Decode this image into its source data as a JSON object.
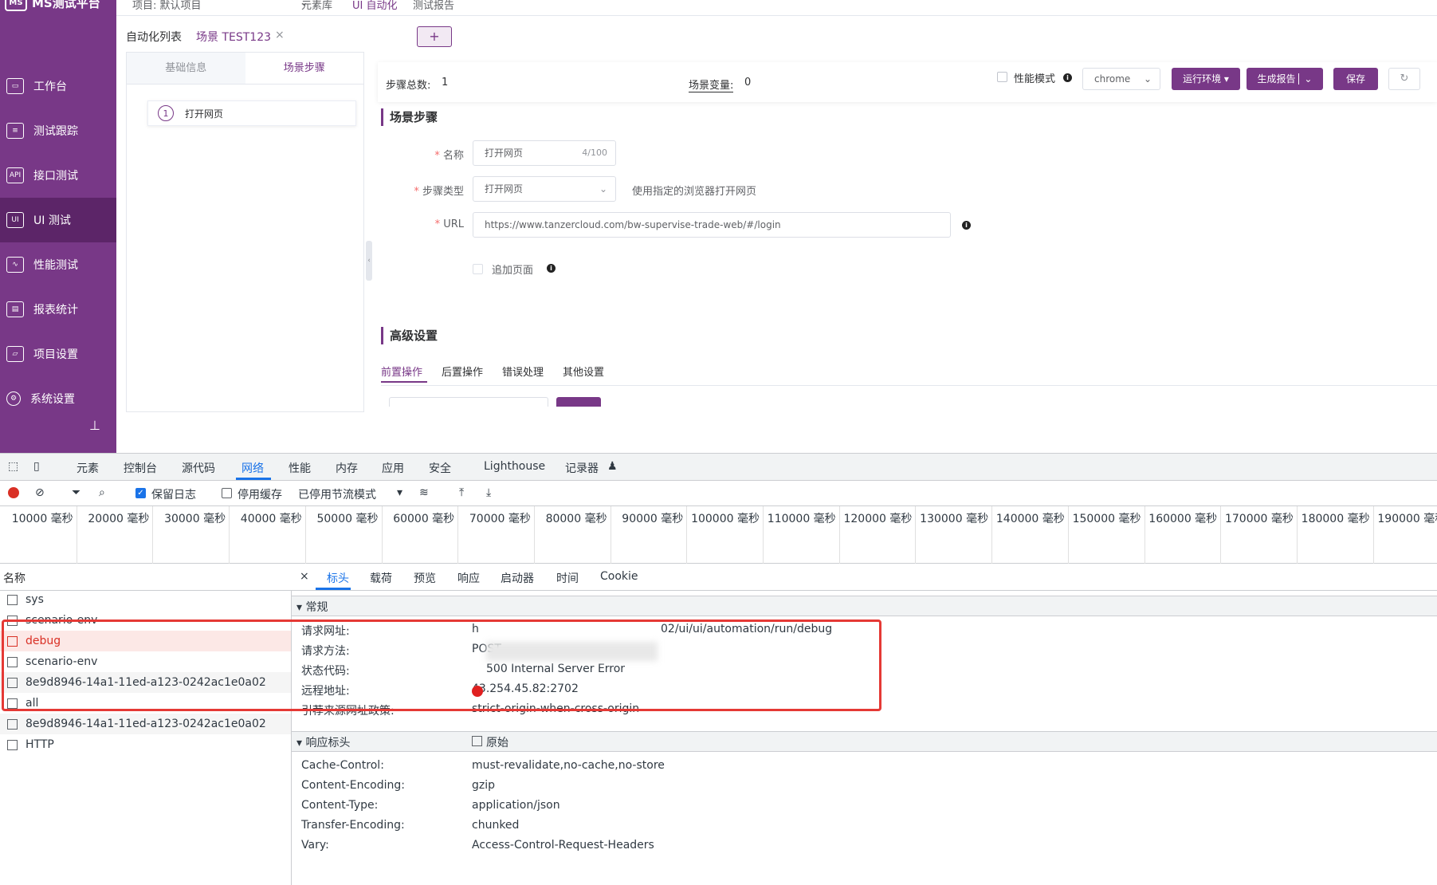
{
  "app": {
    "logo_text": "MS测试平台",
    "logo_mark": "MS"
  },
  "topbar": {
    "project": "项目: 默认项目",
    "tabs": [
      "元素库",
      "UI 自动化",
      "测试报告"
    ]
  },
  "sidebar": {
    "items": [
      {
        "label": "工作台",
        "icon": "monitor-icon"
      },
      {
        "label": "测试跟踪",
        "icon": "clipboard-icon"
      },
      {
        "label": "接口测试",
        "icon": "api-icon"
      },
      {
        "label": "UI 测试",
        "icon": "ui-icon",
        "active": true
      },
      {
        "label": "性能测试",
        "icon": "chart-icon"
      },
      {
        "label": "报表统计",
        "icon": "report-icon"
      },
      {
        "label": "项目设置",
        "icon": "folder-icon"
      },
      {
        "label": "系统设置",
        "icon": "gear-icon"
      }
    ]
  },
  "page_tabs": {
    "list": "自动化列表",
    "scene": "场景 TEST123",
    "close": "×",
    "add": "+"
  },
  "left_panel": {
    "tab_basic": "基础信息",
    "tab_steps": "场景步骤",
    "step_num": "1",
    "step_label": "打开网页"
  },
  "toolbar": {
    "steps_total_label": "步骤总数:",
    "steps_total": "1",
    "scene_var_label": "场景变量:",
    "scene_var": "0",
    "perf_mode": "性能模式",
    "browser": "chrome",
    "run_env": "运行环境",
    "gen_report": "生成报告",
    "save": "保存",
    "accent": "#783887"
  },
  "scene_steps": {
    "title": "场景步骤",
    "name_label": "名称",
    "name_value": "打开网页",
    "name_count": "4/100",
    "type_label": "步骤类型",
    "type_value": "打开网页",
    "type_hint": "使用指定的浏览器打开网页",
    "url_label": "URL",
    "url_value": "https://www.tanzercloud.com/bw-supervise-trade-web/#/login",
    "append_page": "追加页面"
  },
  "advanced": {
    "title": "高级设置",
    "tabs": [
      "前置操作",
      "后置操作",
      "错误处理",
      "其他设置"
    ]
  },
  "devtools": {
    "tabs": [
      "元素",
      "控制台",
      "源代码",
      "网络",
      "性能",
      "内存",
      "应用",
      "安全",
      "Lighthouse",
      "记录器"
    ],
    "preserve_log": "保留日志",
    "disable_cache": "停用缓存",
    "throttle": "已停用节流模式",
    "ticks": [
      "10000 毫秒",
      "20000 毫秒",
      "30000 毫秒",
      "40000 毫秒",
      "50000 毫秒",
      "60000 毫秒",
      "70000 毫秒",
      "80000 毫秒",
      "90000 毫秒",
      "100000 毫秒",
      "110000 毫秒",
      "120000 毫秒",
      "130000 毫秒",
      "140000 毫秒",
      "150000 毫秒",
      "160000 毫秒",
      "170000 毫秒",
      "180000 毫秒",
      "190000 毫秒"
    ],
    "name_header": "名称",
    "requests": [
      "sys",
      "scenario-env",
      "debug",
      "scenario-env",
      "8e9d8946-14a1-11ed-a123-0242ac1e0a02",
      "all",
      "8e9d8946-14a1-11ed-a123-0242ac1e0a02",
      "HTTP"
    ],
    "detail_tabs": [
      "×",
      "标头",
      "载荷",
      "预览",
      "响应",
      "启动器",
      "时间",
      "Cookie"
    ],
    "general": {
      "title": "常规",
      "url_label": "请求网址:",
      "url_prefix": "h",
      "url_suffix": "02/ui/ui/automation/run/debug",
      "method_label": "请求方法:",
      "method": "POST",
      "status_label": "状态代码:",
      "status": "500 Internal Server Error",
      "remote_label": "远程地址:",
      "remote": "43.254.45.82:2702",
      "referrer_label": "引荐来源网址政策:",
      "referrer": "strict-origin-when-cross-origin"
    },
    "response_headers": {
      "title": "响应标头",
      "raw": "原始",
      "rows": [
        {
          "k": "Cache-Control:",
          "v": "must-revalidate,no-cache,no-store"
        },
        {
          "k": "Content-Encoding:",
          "v": "gzip"
        },
        {
          "k": "Content-Type:",
          "v": "application/json"
        },
        {
          "k": "Transfer-Encoding:",
          "v": "chunked"
        },
        {
          "k": "Vary:",
          "v": "Access-Control-Request-Headers"
        }
      ]
    }
  }
}
